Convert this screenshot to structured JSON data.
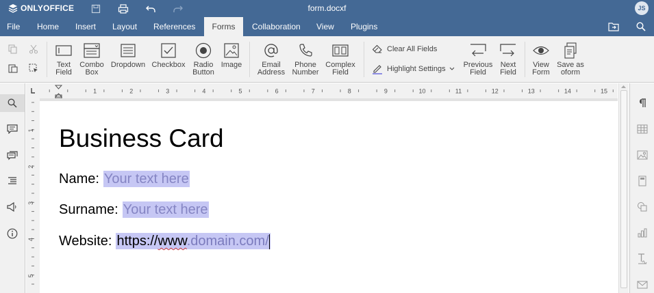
{
  "app": {
    "name": "ONLYOFFICE",
    "doc_title": "form.docxf",
    "user_initials": "JS"
  },
  "menu": {
    "tabs": [
      "File",
      "Home",
      "Insert",
      "Layout",
      "References",
      "Forms",
      "Collaboration",
      "View",
      "Plugins"
    ],
    "active": "Forms"
  },
  "toolbar": {
    "text_field": "Text\nField",
    "combo_box": "Combo\nBox",
    "dropdown": "Dropdown",
    "checkbox": "Checkbox",
    "radio_button": "Radio\nButton",
    "image": "Image",
    "email_address": "Email\nAddress",
    "phone_number": "Phone\nNumber",
    "complex_field": "Complex\nField",
    "clear_all_fields": "Clear All Fields",
    "highlight_settings": "Highlight Settings",
    "previous_field": "Previous\nField",
    "next_field": "Next\nField",
    "view_form": "View\nForm",
    "save_as_oform": "Save as\noform"
  },
  "ruler": {
    "numbers": [
      "1",
      "2",
      "3",
      "4",
      "5",
      "6",
      "7",
      "8",
      "9",
      "10",
      "11",
      "12",
      "13",
      "14",
      "15"
    ],
    "v_numbers": [
      "1",
      "2",
      "3",
      "4",
      "5"
    ]
  },
  "document": {
    "heading": "Business Card",
    "name_label": "Name:",
    "name_placeholder": "Your text here",
    "surname_label": "Surname:",
    "surname_placeholder": "Your text here",
    "website_label": "Website:",
    "website_value_a": "https://",
    "website_value_b": "www",
    "website_value_c": ".domain.com/"
  },
  "colors": {
    "accent": "#446995",
    "toolbar_bg": "#f1f1f1",
    "field_highlight": "#c6c7f4"
  }
}
